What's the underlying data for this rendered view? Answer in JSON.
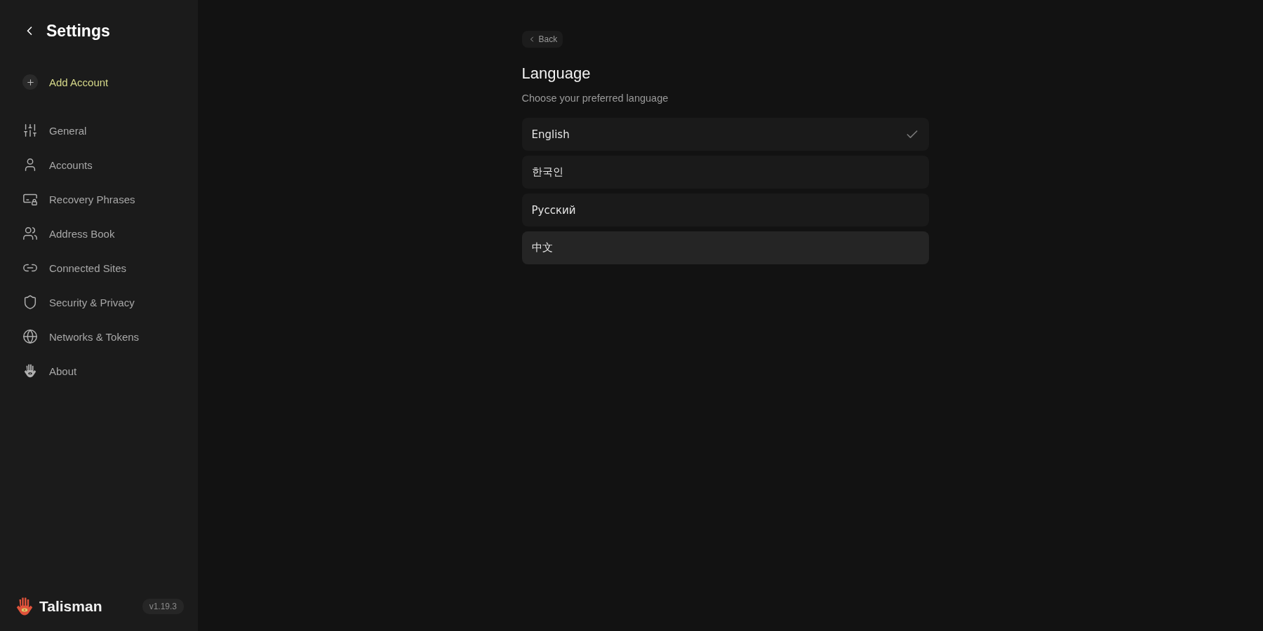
{
  "sidebar": {
    "title": "Settings",
    "add_account": "Add Account",
    "items": [
      {
        "kind": "sliders",
        "label": "General"
      },
      {
        "kind": "user",
        "label": "Accounts"
      },
      {
        "kind": "keylock",
        "label": "Recovery Phrases"
      },
      {
        "kind": "users",
        "label": "Address Book"
      },
      {
        "kind": "link",
        "label": "Connected Sites"
      },
      {
        "kind": "shield",
        "label": "Security & Privacy"
      },
      {
        "kind": "globe",
        "label": "Networks & Tokens"
      },
      {
        "kind": "hand",
        "label": "About"
      }
    ],
    "brand": "Talisman",
    "version": "v1.19.3"
  },
  "main": {
    "back": "Back",
    "title": "Language",
    "subtitle": "Choose your preferred language",
    "options": [
      {
        "label": "English",
        "selected": true,
        "highlighted": false
      },
      {
        "label": "한국인",
        "selected": false,
        "highlighted": false
      },
      {
        "label": "Русский",
        "selected": false,
        "highlighted": false
      },
      {
        "label": "中文",
        "selected": false,
        "highlighted": true
      }
    ]
  }
}
